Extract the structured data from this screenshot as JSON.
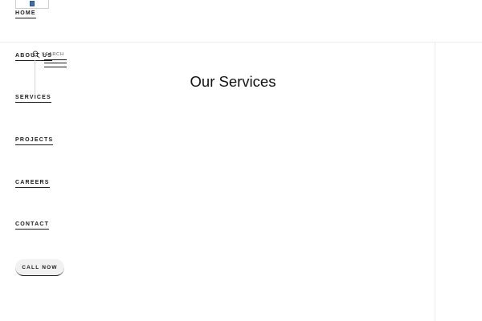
{
  "nav": {
    "items": [
      {
        "label": "HOME"
      },
      {
        "label": "ABOUT US"
      },
      {
        "label": "SERVICES"
      },
      {
        "label": "PROJECTS"
      },
      {
        "label": "CAREERS"
      },
      {
        "label": "CONTACT"
      }
    ],
    "call_label": "CALL NOW"
  },
  "search": {
    "label": "SEARCH",
    "icon": "search-icon"
  },
  "main": {
    "title": "Our Services"
  },
  "colors": {
    "text": "#1a1a1a",
    "divider": "#ececec",
    "button_bg": "#f1f1f1",
    "logo_accent": "#3c6fb0"
  }
}
